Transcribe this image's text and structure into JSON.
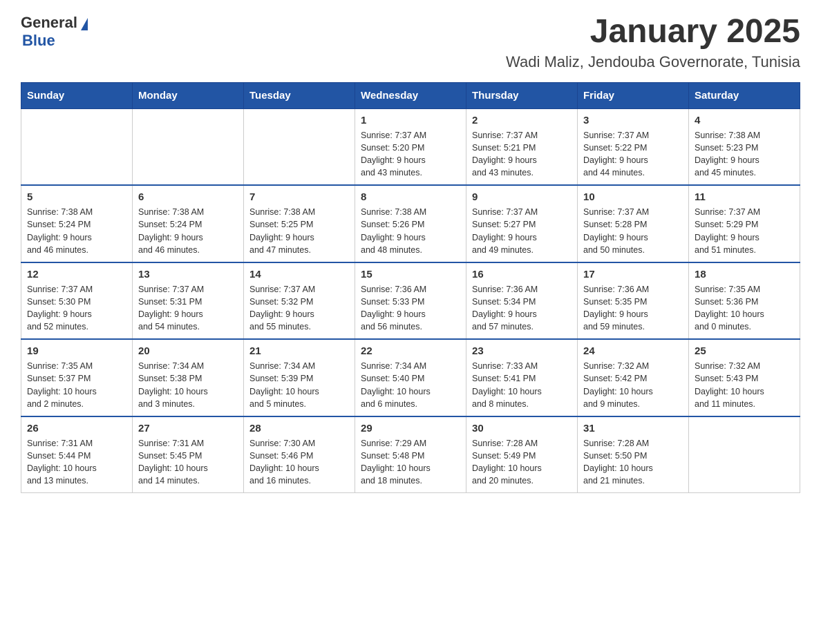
{
  "logo": {
    "general": "General",
    "blue": "Blue"
  },
  "title": "January 2025",
  "subtitle": "Wadi Maliz, Jendouba Governorate, Tunisia",
  "days_of_week": [
    "Sunday",
    "Monday",
    "Tuesday",
    "Wednesday",
    "Thursday",
    "Friday",
    "Saturday"
  ],
  "weeks": [
    [
      {
        "day": "",
        "info": ""
      },
      {
        "day": "",
        "info": ""
      },
      {
        "day": "",
        "info": ""
      },
      {
        "day": "1",
        "info": "Sunrise: 7:37 AM\nSunset: 5:20 PM\nDaylight: 9 hours\nand 43 minutes."
      },
      {
        "day": "2",
        "info": "Sunrise: 7:37 AM\nSunset: 5:21 PM\nDaylight: 9 hours\nand 43 minutes."
      },
      {
        "day": "3",
        "info": "Sunrise: 7:37 AM\nSunset: 5:22 PM\nDaylight: 9 hours\nand 44 minutes."
      },
      {
        "day": "4",
        "info": "Sunrise: 7:38 AM\nSunset: 5:23 PM\nDaylight: 9 hours\nand 45 minutes."
      }
    ],
    [
      {
        "day": "5",
        "info": "Sunrise: 7:38 AM\nSunset: 5:24 PM\nDaylight: 9 hours\nand 46 minutes."
      },
      {
        "day": "6",
        "info": "Sunrise: 7:38 AM\nSunset: 5:24 PM\nDaylight: 9 hours\nand 46 minutes."
      },
      {
        "day": "7",
        "info": "Sunrise: 7:38 AM\nSunset: 5:25 PM\nDaylight: 9 hours\nand 47 minutes."
      },
      {
        "day": "8",
        "info": "Sunrise: 7:38 AM\nSunset: 5:26 PM\nDaylight: 9 hours\nand 48 minutes."
      },
      {
        "day": "9",
        "info": "Sunrise: 7:37 AM\nSunset: 5:27 PM\nDaylight: 9 hours\nand 49 minutes."
      },
      {
        "day": "10",
        "info": "Sunrise: 7:37 AM\nSunset: 5:28 PM\nDaylight: 9 hours\nand 50 minutes."
      },
      {
        "day": "11",
        "info": "Sunrise: 7:37 AM\nSunset: 5:29 PM\nDaylight: 9 hours\nand 51 minutes."
      }
    ],
    [
      {
        "day": "12",
        "info": "Sunrise: 7:37 AM\nSunset: 5:30 PM\nDaylight: 9 hours\nand 52 minutes."
      },
      {
        "day": "13",
        "info": "Sunrise: 7:37 AM\nSunset: 5:31 PM\nDaylight: 9 hours\nand 54 minutes."
      },
      {
        "day": "14",
        "info": "Sunrise: 7:37 AM\nSunset: 5:32 PM\nDaylight: 9 hours\nand 55 minutes."
      },
      {
        "day": "15",
        "info": "Sunrise: 7:36 AM\nSunset: 5:33 PM\nDaylight: 9 hours\nand 56 minutes."
      },
      {
        "day": "16",
        "info": "Sunrise: 7:36 AM\nSunset: 5:34 PM\nDaylight: 9 hours\nand 57 minutes."
      },
      {
        "day": "17",
        "info": "Sunrise: 7:36 AM\nSunset: 5:35 PM\nDaylight: 9 hours\nand 59 minutes."
      },
      {
        "day": "18",
        "info": "Sunrise: 7:35 AM\nSunset: 5:36 PM\nDaylight: 10 hours\nand 0 minutes."
      }
    ],
    [
      {
        "day": "19",
        "info": "Sunrise: 7:35 AM\nSunset: 5:37 PM\nDaylight: 10 hours\nand 2 minutes."
      },
      {
        "day": "20",
        "info": "Sunrise: 7:34 AM\nSunset: 5:38 PM\nDaylight: 10 hours\nand 3 minutes."
      },
      {
        "day": "21",
        "info": "Sunrise: 7:34 AM\nSunset: 5:39 PM\nDaylight: 10 hours\nand 5 minutes."
      },
      {
        "day": "22",
        "info": "Sunrise: 7:34 AM\nSunset: 5:40 PM\nDaylight: 10 hours\nand 6 minutes."
      },
      {
        "day": "23",
        "info": "Sunrise: 7:33 AM\nSunset: 5:41 PM\nDaylight: 10 hours\nand 8 minutes."
      },
      {
        "day": "24",
        "info": "Sunrise: 7:32 AM\nSunset: 5:42 PM\nDaylight: 10 hours\nand 9 minutes."
      },
      {
        "day": "25",
        "info": "Sunrise: 7:32 AM\nSunset: 5:43 PM\nDaylight: 10 hours\nand 11 minutes."
      }
    ],
    [
      {
        "day": "26",
        "info": "Sunrise: 7:31 AM\nSunset: 5:44 PM\nDaylight: 10 hours\nand 13 minutes."
      },
      {
        "day": "27",
        "info": "Sunrise: 7:31 AM\nSunset: 5:45 PM\nDaylight: 10 hours\nand 14 minutes."
      },
      {
        "day": "28",
        "info": "Sunrise: 7:30 AM\nSunset: 5:46 PM\nDaylight: 10 hours\nand 16 minutes."
      },
      {
        "day": "29",
        "info": "Sunrise: 7:29 AM\nSunset: 5:48 PM\nDaylight: 10 hours\nand 18 minutes."
      },
      {
        "day": "30",
        "info": "Sunrise: 7:28 AM\nSunset: 5:49 PM\nDaylight: 10 hours\nand 20 minutes."
      },
      {
        "day": "31",
        "info": "Sunrise: 7:28 AM\nSunset: 5:50 PM\nDaylight: 10 hours\nand 21 minutes."
      },
      {
        "day": "",
        "info": ""
      }
    ]
  ]
}
